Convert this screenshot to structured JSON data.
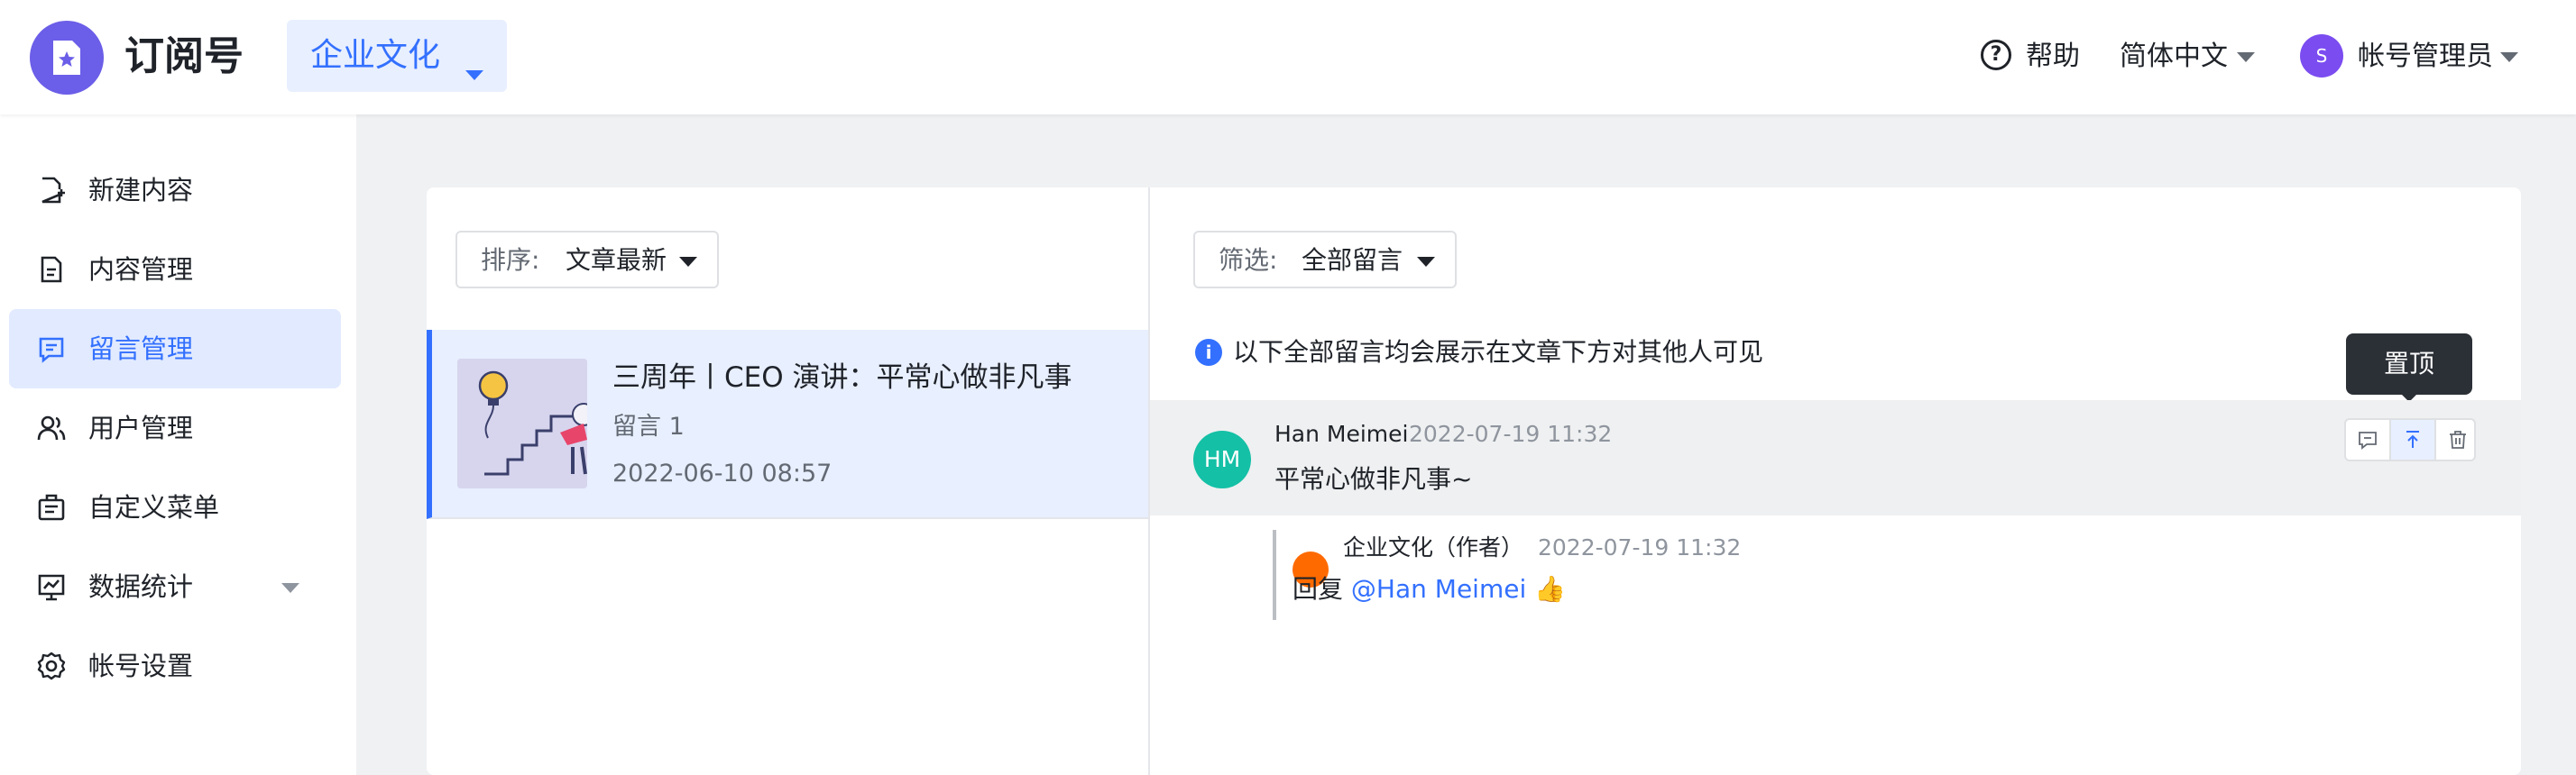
{
  "header": {
    "app_title": "订阅号",
    "account_name": "企业文化",
    "help_label": "帮助",
    "language_label": "简体中文",
    "user_avatar_initial": "S",
    "user_name": "帐号管理员"
  },
  "sidebar": {
    "items": [
      {
        "label": "新建内容",
        "icon": "new-doc-icon"
      },
      {
        "label": "内容管理",
        "icon": "document-icon"
      },
      {
        "label": "留言管理",
        "icon": "comment-icon",
        "active": true
      },
      {
        "label": "用户管理",
        "icon": "users-icon"
      },
      {
        "label": "自定义菜单",
        "icon": "menu-icon"
      },
      {
        "label": "数据统计",
        "icon": "chart-icon",
        "expandable": true
      },
      {
        "label": "帐号设置",
        "icon": "gear-icon"
      }
    ]
  },
  "articles_panel": {
    "sort_key": "排序:",
    "sort_value": "文章最新",
    "items": [
      {
        "title": "三周年丨CEO 演讲：平常心做非凡事",
        "comment_count": "留言 1",
        "date": "2022-06-10 08:57"
      }
    ]
  },
  "comments_panel": {
    "filter_key": "筛选:",
    "filter_value": "全部留言",
    "notice": "以下全部留言均会展示在文章下方对其他人可见",
    "tooltip": "置顶",
    "comment": {
      "avatar": "HM",
      "author": "Han Meimei",
      "time": "2022-07-19 11:32",
      "text": "平常心做非凡事~"
    },
    "reply": {
      "author": "企业文化（作者）",
      "time": "2022-07-19 11:32",
      "prefix": "回复",
      "mention": "@Han Meimei",
      "emoji": "👍"
    }
  },
  "colors": {
    "accent": "#3370ff",
    "logo": "#6b5ee8",
    "comment_avatar": "#14c0a6",
    "reply_avatar": "#ff6a00",
    "user_avatar": "#7b4cf0"
  }
}
